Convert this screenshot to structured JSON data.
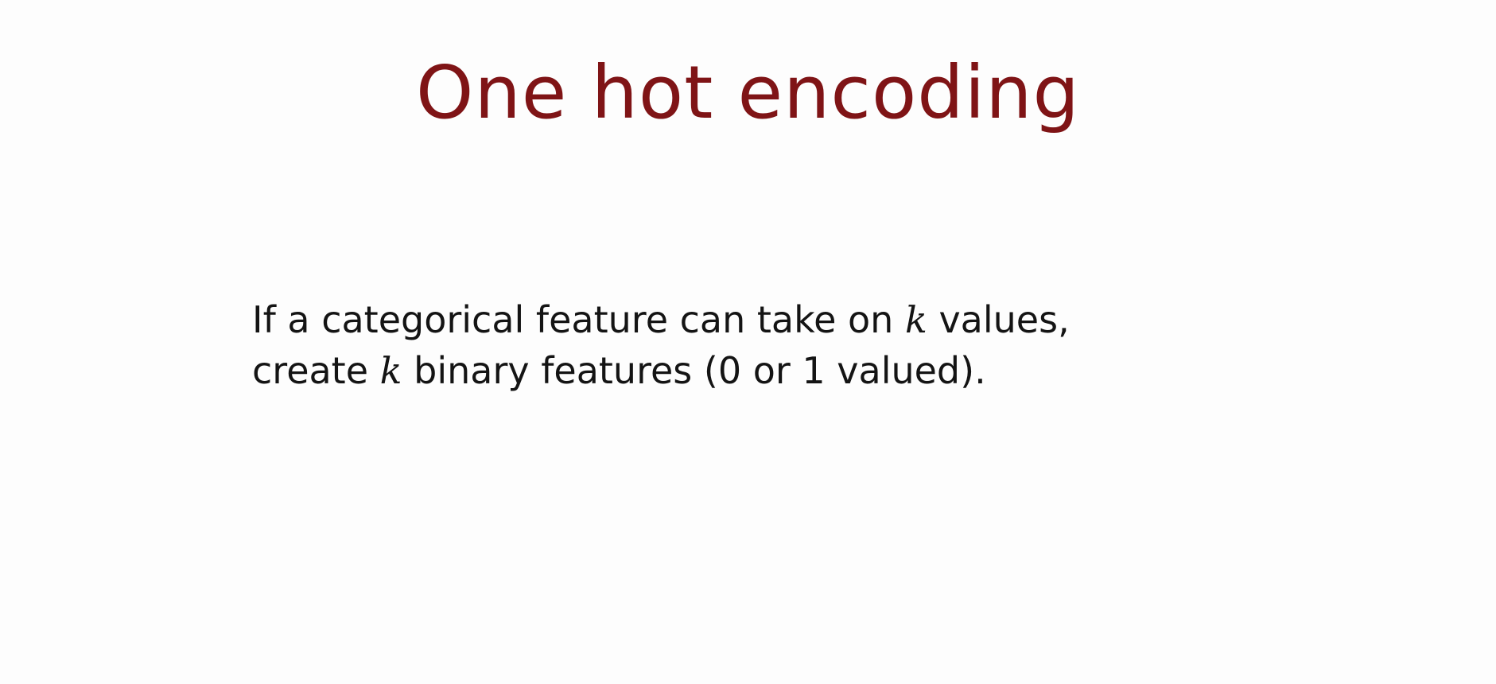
{
  "slide": {
    "title": "One hot encoding",
    "body": {
      "line1_before": "If a categorical feature can take on ",
      "line1_var": "k",
      "line1_after": " values,",
      "line2_before": "create ",
      "line2_var": "k",
      "line2_after": " binary features (0 or 1 valued)."
    },
    "colors": {
      "title": "#7f1416",
      "text": "#141414",
      "background": "#fdfdfd"
    }
  }
}
